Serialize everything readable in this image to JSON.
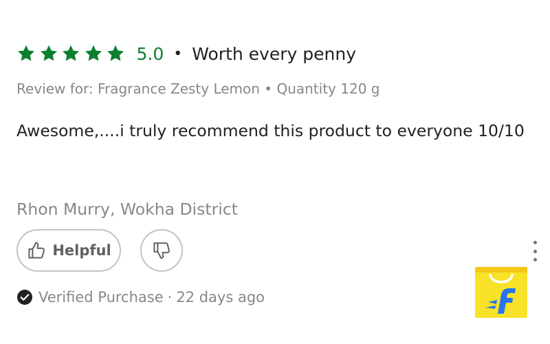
{
  "review": {
    "rating_value": "5.0",
    "rating_stars": 5,
    "separator": "•",
    "headline": "Worth every penny",
    "review_for": "Review for: Fragrance Zesty Lemon • Quantity 120 g",
    "body": "Awesome,....i truly recommend this product to everyone 10/10",
    "reviewer": "Rhon Murry, Wokha District"
  },
  "actions": {
    "helpful_label": "Helpful"
  },
  "footer": {
    "verified_label": "Verified Purchase",
    "separator": "·",
    "age": "22 days ago"
  },
  "colors": {
    "star_green": "#0b7f2e",
    "muted_text": "#878787",
    "primary_text": "#212121",
    "logo_yellow": "#f8e228",
    "logo_blue": "#2874f0"
  },
  "icons": {
    "star": "star-icon",
    "thumb_up": "thumbs-up-icon",
    "thumb_down": "thumbs-down-icon",
    "more": "more-vertical-icon",
    "verified": "check-circle-icon",
    "logo": "shopping-bag-logo"
  }
}
